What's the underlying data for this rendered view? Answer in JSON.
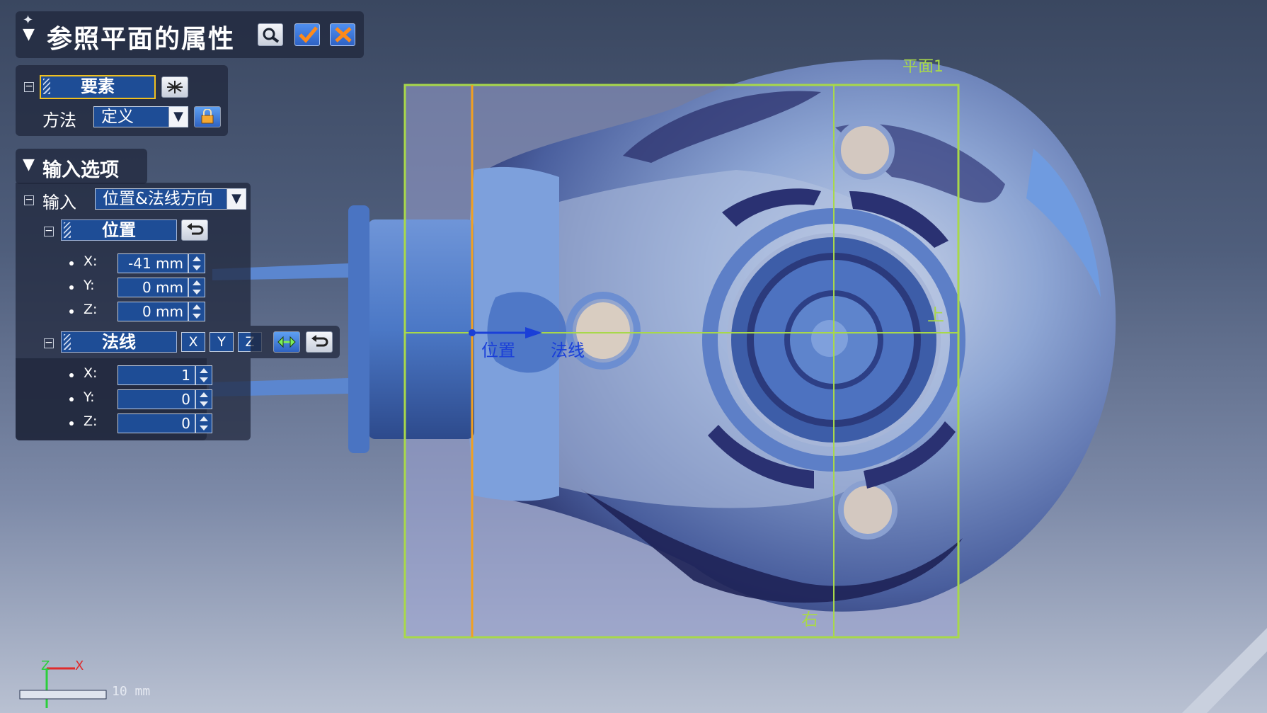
{
  "dialog": {
    "title": "参照平面的属性",
    "buttons": [
      "preview",
      "ok",
      "cancel"
    ],
    "element_label": "要素",
    "method_label": "方法",
    "method_value": "定义",
    "input_options_label": "输入选项",
    "input_label": "输入",
    "input_value": "位置&法线方向",
    "position_label": "位置",
    "position": {
      "x": "-41 mm",
      "y": "0 mm",
      "z": "0 mm"
    },
    "normal_label": "法线",
    "normal_axis_buttons": [
      "X",
      "Y",
      "Z"
    ],
    "normal": {
      "x": "1",
      "y": "0",
      "z": "0"
    },
    "axis_labels": [
      "X:",
      "Y:",
      "Z:"
    ]
  },
  "viewport": {
    "plane_label": "平面1",
    "position_marker": "位置",
    "normal_marker": "法线",
    "top_label": "上",
    "right_label": "右",
    "scale_value": "10 mm",
    "triad": {
      "x": "X",
      "z": "Z"
    }
  },
  "colors": {
    "plane_frame": "#a8d84a",
    "plane_fill": "#9aa0cc",
    "section_line": "#f2a020",
    "marker_text": "#1a3fd8",
    "scan_blue": "#4f82cf",
    "panel_field": "#1e4d96"
  }
}
